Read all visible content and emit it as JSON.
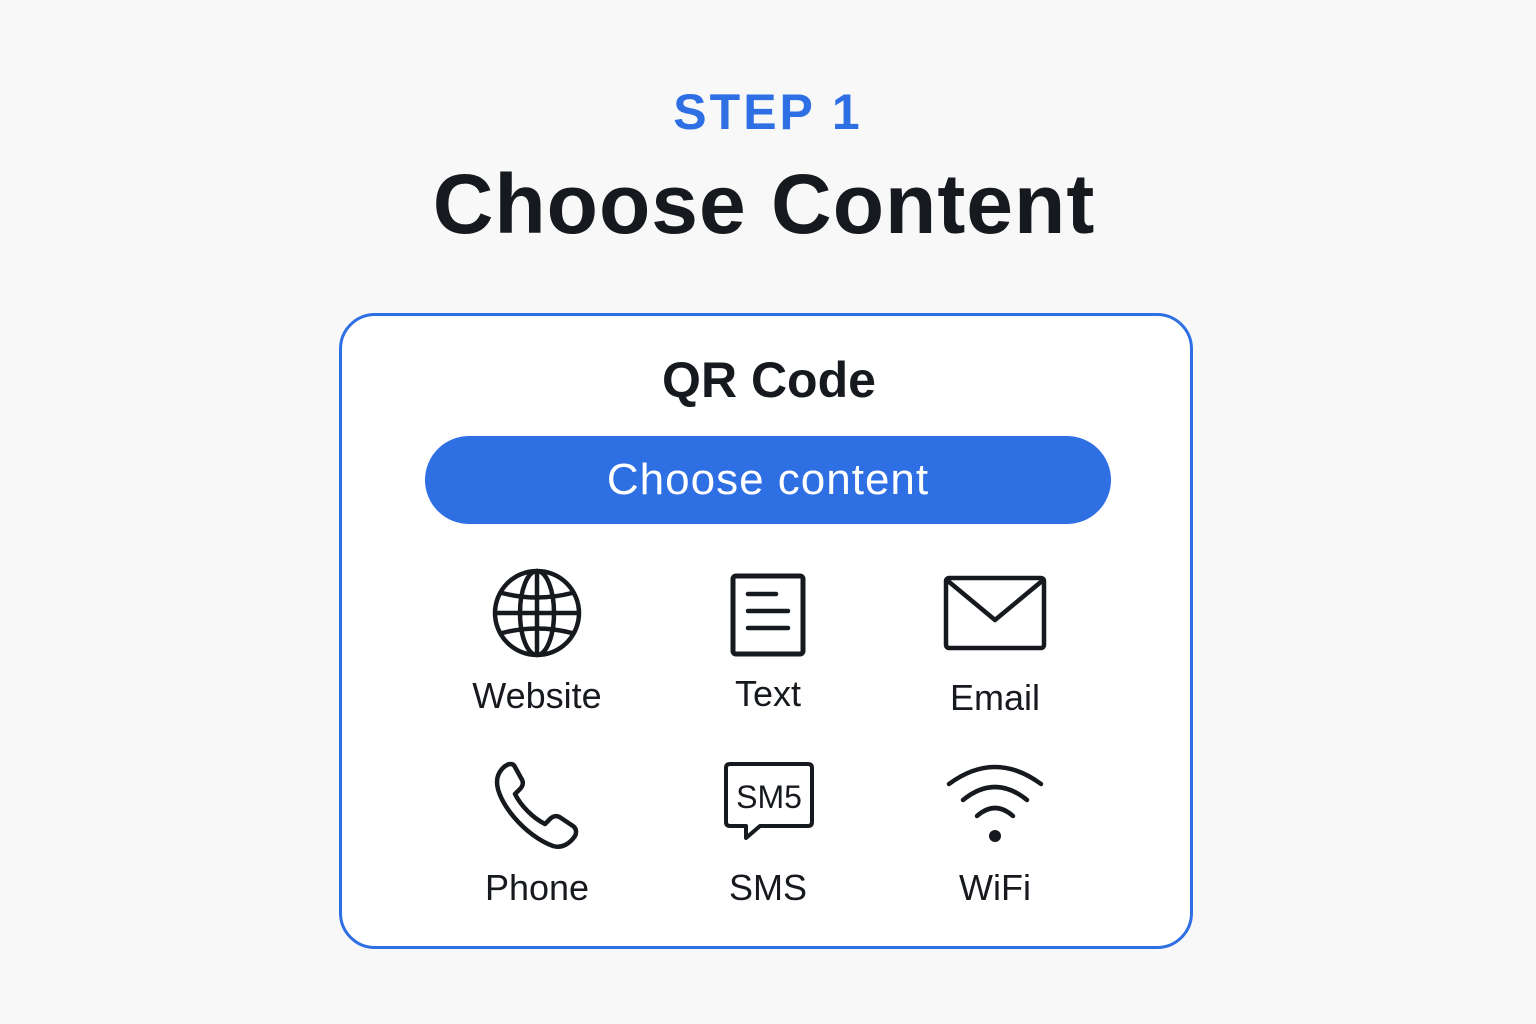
{
  "header": {
    "step_label": "STEP 1",
    "title": "Choose Content"
  },
  "card": {
    "title": "QR Code",
    "button_label": "Choose content",
    "options": [
      {
        "label": "Website",
        "icon": "globe-icon"
      },
      {
        "label": "Text",
        "icon": "document-icon"
      },
      {
        "label": "Email",
        "icon": "envelope-icon"
      },
      {
        "label": "Phone",
        "icon": "phone-icon"
      },
      {
        "label": "SMS",
        "icon": "sms-bubble-icon",
        "icon_text": "SM5"
      },
      {
        "label": "WiFi",
        "icon": "wifi-icon"
      }
    ]
  },
  "colors": {
    "accent": "#2f6fe4",
    "text": "#16191d",
    "background": "#f8f8f9",
    "card_background": "#ffffff"
  }
}
